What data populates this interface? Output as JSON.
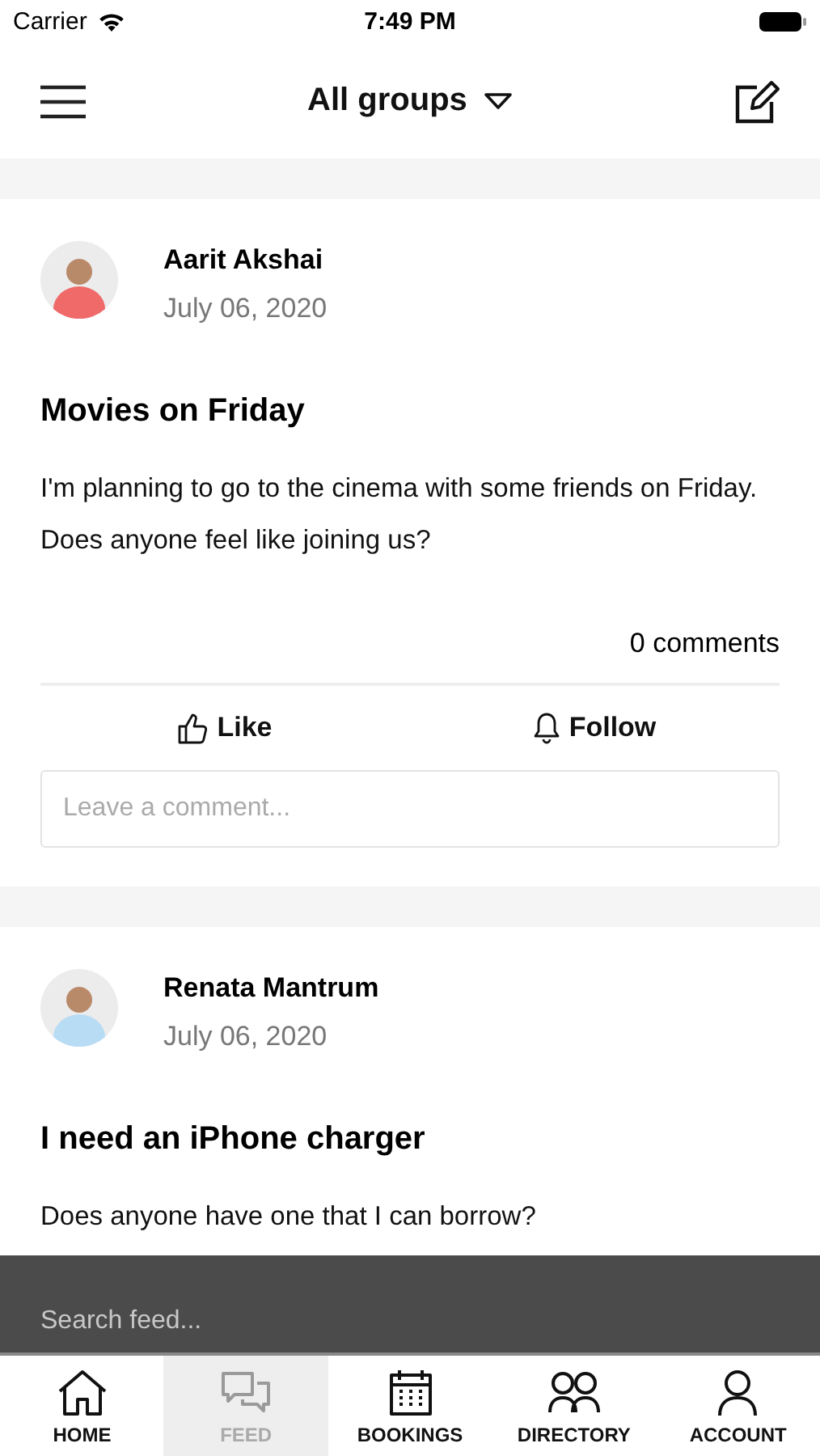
{
  "status_bar": {
    "carrier": "Carrier",
    "time": "7:49 PM"
  },
  "nav": {
    "title": "All groups"
  },
  "posts": [
    {
      "author": "Aarit Akshai",
      "date": "July 06, 2020",
      "title": "Movies on Friday",
      "body": "I'm planning to go to the cinema with some friends on Friday. Does anyone feel like joining us?",
      "comments": "0 comments",
      "like": "Like",
      "follow": "Follow",
      "comment_placeholder": "Leave a comment..."
    },
    {
      "author": "Renata Mantrum",
      "date": "July 06, 2020",
      "title": "I need an iPhone charger",
      "body": "Does anyone have one that I can borrow?"
    }
  ],
  "search": {
    "placeholder": "Search feed..."
  },
  "tabs": [
    {
      "label": "HOME",
      "kind": "home",
      "selected": false
    },
    {
      "label": "FEED",
      "kind": "feed",
      "selected": true
    },
    {
      "label": "BOOKINGS",
      "kind": "bookings",
      "selected": false
    },
    {
      "label": "DIRECTORY",
      "kind": "directory",
      "selected": false
    },
    {
      "label": "ACCOUNT",
      "kind": "account",
      "selected": false
    }
  ]
}
